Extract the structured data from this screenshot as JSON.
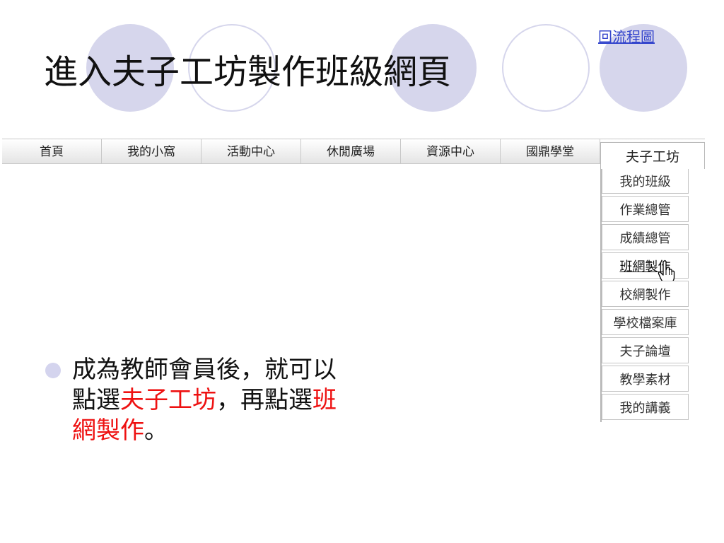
{
  "slide": {
    "back_link": "回流程圖",
    "title": "進入夫子工坊製作班級網頁"
  },
  "nav": {
    "tabs": [
      "首頁",
      "我的小窩",
      "活動中心",
      "休閒廣場",
      "資源中心",
      "國鼎學堂"
    ],
    "active_tab": "夫子工坊"
  },
  "submenu": {
    "items": [
      "我的班級",
      "作業總管",
      "成績總管",
      "班網製作",
      "校網製作",
      "學校檔案庫",
      "夫子論壇",
      "教學素材",
      "我的講義"
    ],
    "hovered_item": "班網製作"
  },
  "bullet": {
    "line1": "成為教師會員後，就可以",
    "line2_a": "點選",
    "line2_b": "夫子工坊",
    "line2_c": "，再點選",
    "line2_d": "班",
    "line3_a": "網製作",
    "line3_b": "。"
  },
  "colors": {
    "highlight": "#ee1111",
    "deco_circle": "#d6d6ec",
    "link": "#3344cc"
  },
  "icons": {
    "cursor": "hand-pointer-icon",
    "bullet": "bullet-dot-icon"
  }
}
